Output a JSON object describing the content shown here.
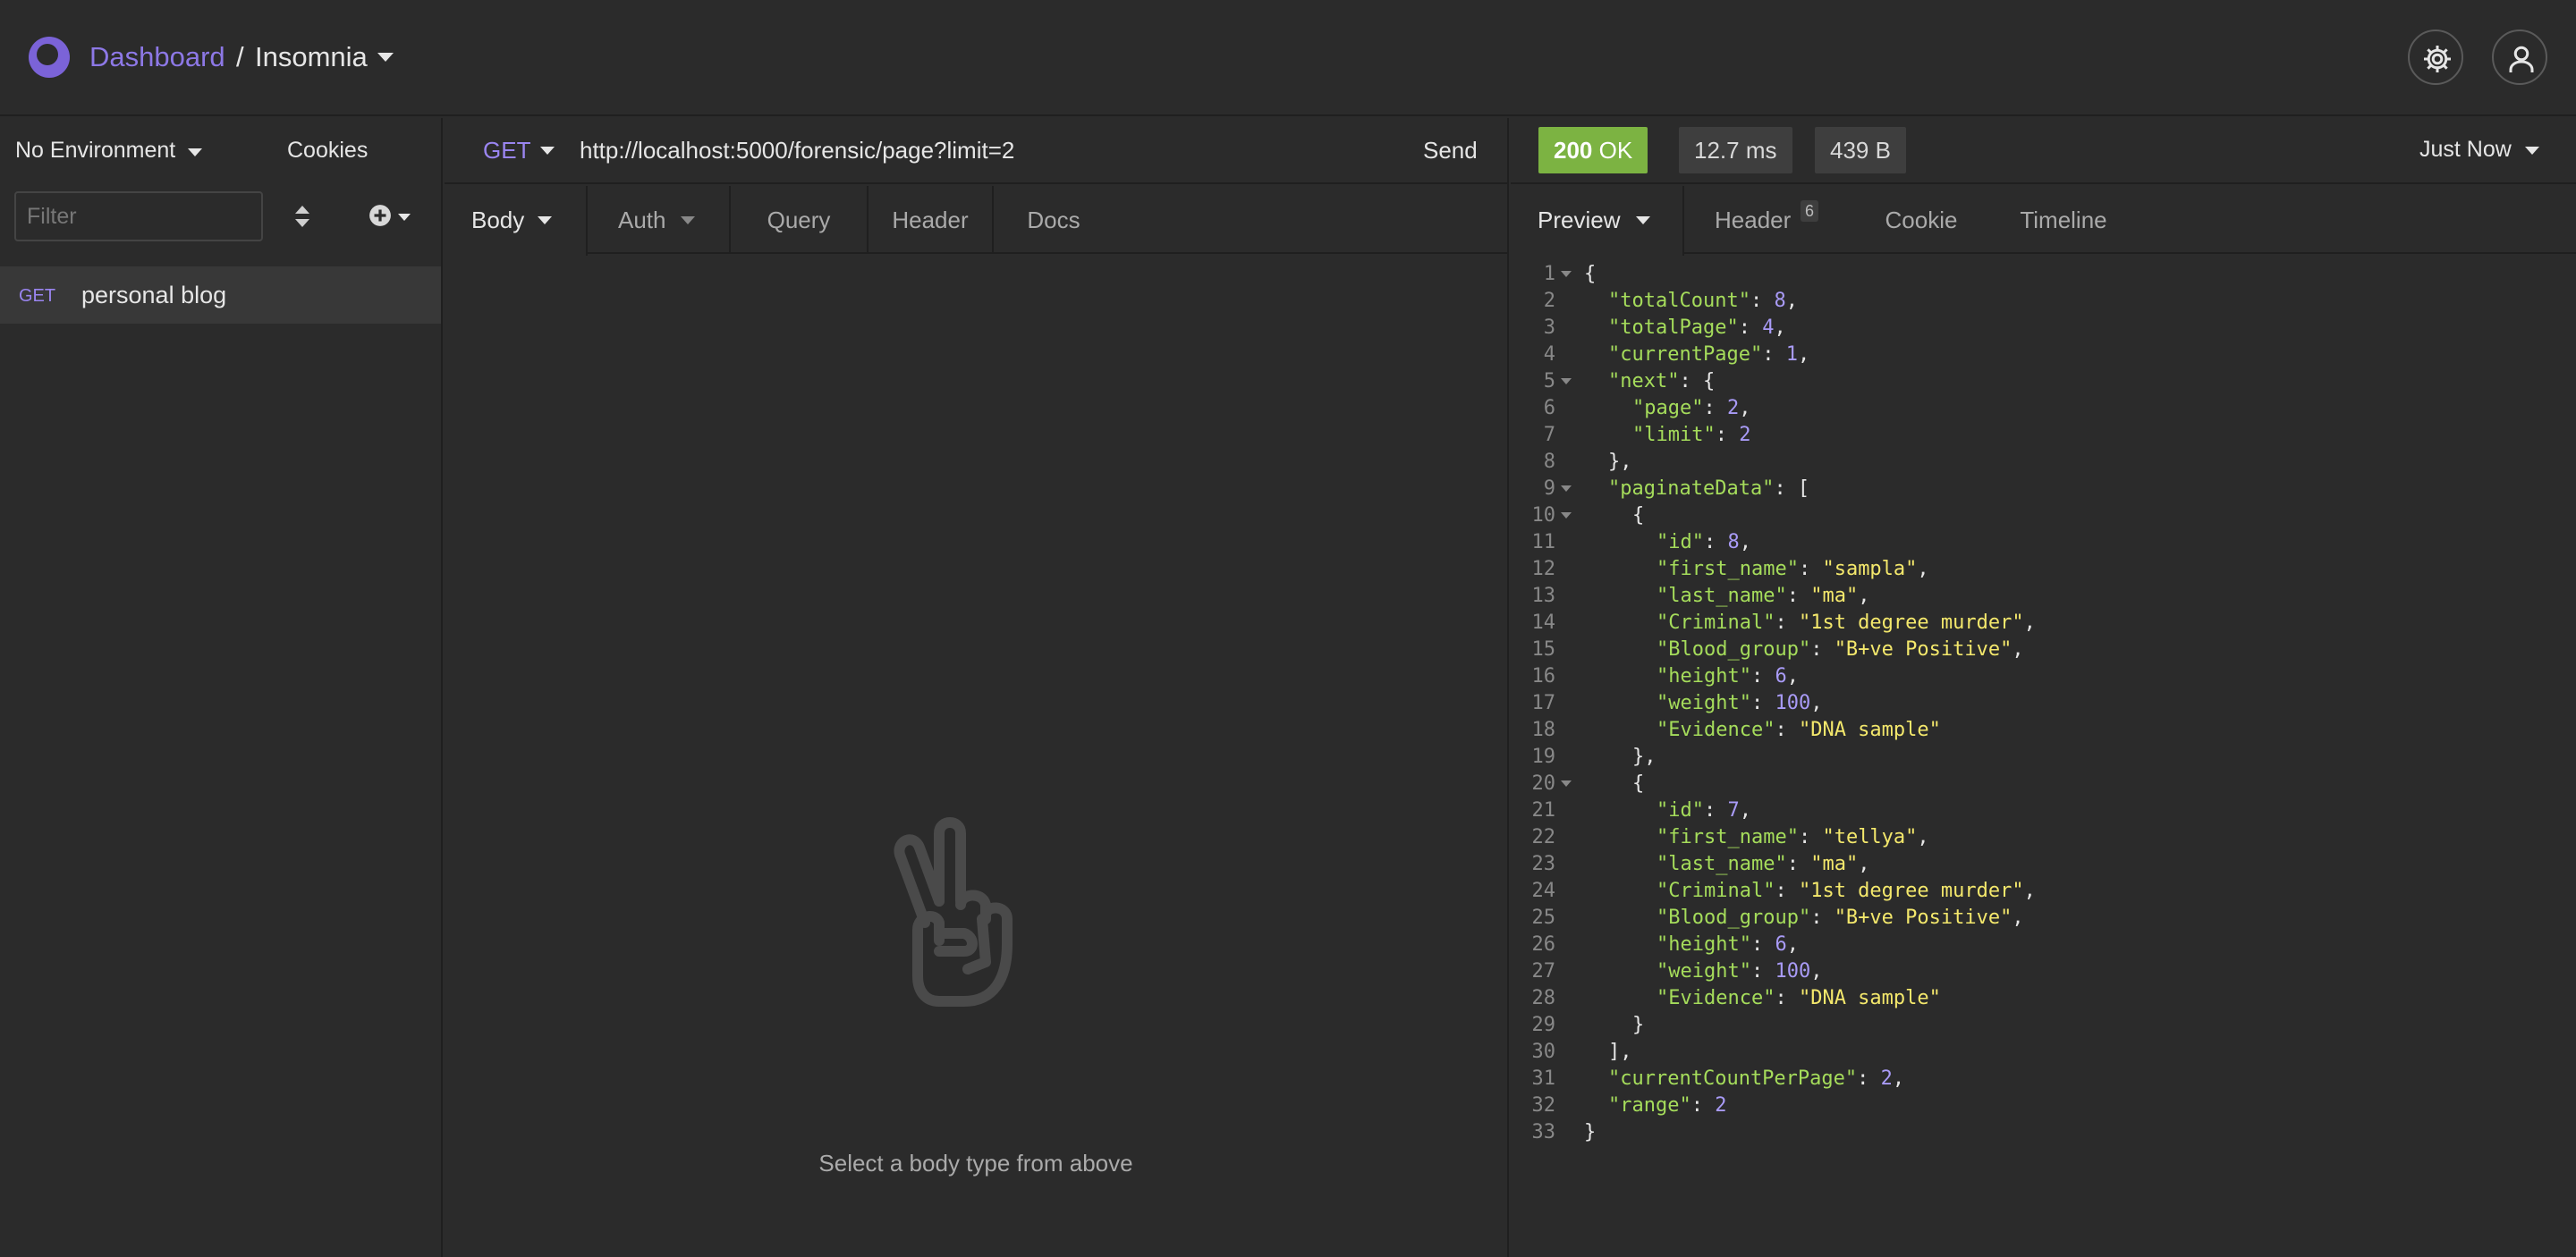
{
  "header": {
    "dashboard_label": "Dashboard",
    "separator": "/",
    "project_label": "Insomnia"
  },
  "sidebar": {
    "environment_label": "No Environment",
    "cookies_label": "Cookies",
    "filter_placeholder": "Filter",
    "requests": [
      {
        "method": "GET",
        "name": "personal blog"
      }
    ]
  },
  "request": {
    "method": "GET",
    "url": "http://localhost:5000/forensic/page?limit=2",
    "send_label": "Send",
    "tabs": {
      "body": "Body",
      "auth": "Auth",
      "query": "Query",
      "header": "Header",
      "docs": "Docs"
    },
    "empty_message": "Select a body type from above"
  },
  "response": {
    "status_code": "200",
    "status_text": "OK",
    "time": "12.7 ms",
    "size": "439 B",
    "history_label": "Just Now",
    "tabs": {
      "preview": "Preview",
      "header": "Header",
      "header_count": "6",
      "cookie": "Cookie",
      "timeline": "Timeline"
    },
    "lines": [
      {
        "n": "1",
        "fold": true,
        "indent": 0,
        "tokens": [
          [
            "p",
            "{"
          ]
        ]
      },
      {
        "n": "2",
        "indent": 1,
        "tokens": [
          [
            "k",
            "\"totalCount\""
          ],
          [
            "p",
            ": "
          ],
          [
            "n",
            "8"
          ],
          [
            "p",
            ","
          ]
        ]
      },
      {
        "n": "3",
        "indent": 1,
        "tokens": [
          [
            "k",
            "\"totalPage\""
          ],
          [
            "p",
            ": "
          ],
          [
            "n",
            "4"
          ],
          [
            "p",
            ","
          ]
        ]
      },
      {
        "n": "4",
        "indent": 1,
        "tokens": [
          [
            "k",
            "\"currentPage\""
          ],
          [
            "p",
            ": "
          ],
          [
            "n",
            "1"
          ],
          [
            "p",
            ","
          ]
        ]
      },
      {
        "n": "5",
        "fold": true,
        "indent": 1,
        "tokens": [
          [
            "k",
            "\"next\""
          ],
          [
            "p",
            ": {"
          ]
        ]
      },
      {
        "n": "6",
        "indent": 2,
        "tokens": [
          [
            "k",
            "\"page\""
          ],
          [
            "p",
            ": "
          ],
          [
            "n",
            "2"
          ],
          [
            "p",
            ","
          ]
        ]
      },
      {
        "n": "7",
        "indent": 2,
        "tokens": [
          [
            "k",
            "\"limit\""
          ],
          [
            "p",
            ": "
          ],
          [
            "n",
            "2"
          ]
        ]
      },
      {
        "n": "8",
        "indent": 1,
        "tokens": [
          [
            "p",
            "},"
          ]
        ]
      },
      {
        "n": "9",
        "fold": true,
        "indent": 1,
        "tokens": [
          [
            "k",
            "\"paginateData\""
          ],
          [
            "p",
            ": ["
          ]
        ]
      },
      {
        "n": "10",
        "fold": true,
        "indent": 2,
        "tokens": [
          [
            "p",
            "{"
          ]
        ]
      },
      {
        "n": "11",
        "indent": 3,
        "tokens": [
          [
            "k",
            "\"id\""
          ],
          [
            "p",
            ": "
          ],
          [
            "n",
            "8"
          ],
          [
            "p",
            ","
          ]
        ]
      },
      {
        "n": "12",
        "indent": 3,
        "tokens": [
          [
            "k",
            "\"first_name\""
          ],
          [
            "p",
            ": "
          ],
          [
            "s",
            "\"sampla\""
          ],
          [
            "p",
            ","
          ]
        ]
      },
      {
        "n": "13",
        "indent": 3,
        "tokens": [
          [
            "k",
            "\"last_name\""
          ],
          [
            "p",
            ": "
          ],
          [
            "s",
            "\"ma\""
          ],
          [
            "p",
            ","
          ]
        ]
      },
      {
        "n": "14",
        "indent": 3,
        "tokens": [
          [
            "k",
            "\"Criminal\""
          ],
          [
            "p",
            ": "
          ],
          [
            "s",
            "\"1st degree murder\""
          ],
          [
            "p",
            ","
          ]
        ]
      },
      {
        "n": "15",
        "indent": 3,
        "tokens": [
          [
            "k",
            "\"Blood_group\""
          ],
          [
            "p",
            ": "
          ],
          [
            "s",
            "\"B+ve Positive\""
          ],
          [
            "p",
            ","
          ]
        ]
      },
      {
        "n": "16",
        "indent": 3,
        "tokens": [
          [
            "k",
            "\"height\""
          ],
          [
            "p",
            ": "
          ],
          [
            "n",
            "6"
          ],
          [
            "p",
            ","
          ]
        ]
      },
      {
        "n": "17",
        "indent": 3,
        "tokens": [
          [
            "k",
            "\"weight\""
          ],
          [
            "p",
            ": "
          ],
          [
            "n",
            "100"
          ],
          [
            "p",
            ","
          ]
        ]
      },
      {
        "n": "18",
        "indent": 3,
        "tokens": [
          [
            "k",
            "\"Evidence\""
          ],
          [
            "p",
            ": "
          ],
          [
            "s",
            "\"DNA sample\""
          ]
        ]
      },
      {
        "n": "19",
        "indent": 2,
        "tokens": [
          [
            "p",
            "},"
          ]
        ]
      },
      {
        "n": "20",
        "fold": true,
        "indent": 2,
        "tokens": [
          [
            "p",
            "{"
          ]
        ]
      },
      {
        "n": "21",
        "indent": 3,
        "tokens": [
          [
            "k",
            "\"id\""
          ],
          [
            "p",
            ": "
          ],
          [
            "n",
            "7"
          ],
          [
            "p",
            ","
          ]
        ]
      },
      {
        "n": "22",
        "indent": 3,
        "tokens": [
          [
            "k",
            "\"first_name\""
          ],
          [
            "p",
            ": "
          ],
          [
            "s",
            "\"tellya\""
          ],
          [
            "p",
            ","
          ]
        ]
      },
      {
        "n": "23",
        "indent": 3,
        "tokens": [
          [
            "k",
            "\"last_name\""
          ],
          [
            "p",
            ": "
          ],
          [
            "s",
            "\"ma\""
          ],
          [
            "p",
            ","
          ]
        ]
      },
      {
        "n": "24",
        "indent": 3,
        "tokens": [
          [
            "k",
            "\"Criminal\""
          ],
          [
            "p",
            ": "
          ],
          [
            "s",
            "\"1st degree murder\""
          ],
          [
            "p",
            ","
          ]
        ]
      },
      {
        "n": "25",
        "indent": 3,
        "tokens": [
          [
            "k",
            "\"Blood_group\""
          ],
          [
            "p",
            ": "
          ],
          [
            "s",
            "\"B+ve Positive\""
          ],
          [
            "p",
            ","
          ]
        ]
      },
      {
        "n": "26",
        "indent": 3,
        "tokens": [
          [
            "k",
            "\"height\""
          ],
          [
            "p",
            ": "
          ],
          [
            "n",
            "6"
          ],
          [
            "p",
            ","
          ]
        ]
      },
      {
        "n": "27",
        "indent": 3,
        "tokens": [
          [
            "k",
            "\"weight\""
          ],
          [
            "p",
            ": "
          ],
          [
            "n",
            "100"
          ],
          [
            "p",
            ","
          ]
        ]
      },
      {
        "n": "28",
        "indent": 3,
        "tokens": [
          [
            "k",
            "\"Evidence\""
          ],
          [
            "p",
            ": "
          ],
          [
            "s",
            "\"DNA sample\""
          ]
        ]
      },
      {
        "n": "29",
        "indent": 2,
        "tokens": [
          [
            "p",
            "}"
          ]
        ]
      },
      {
        "n": "30",
        "indent": 1,
        "tokens": [
          [
            "p",
            "],"
          ]
        ]
      },
      {
        "n": "31",
        "indent": 1,
        "tokens": [
          [
            "k",
            "\"currentCountPerPage\""
          ],
          [
            "p",
            ": "
          ],
          [
            "n",
            "2"
          ],
          [
            "p",
            ","
          ]
        ]
      },
      {
        "n": "32",
        "indent": 1,
        "tokens": [
          [
            "k",
            "\"range\""
          ],
          [
            "p",
            ": "
          ],
          [
            "n",
            "2"
          ]
        ]
      },
      {
        "n": "33",
        "indent": 0,
        "tokens": [
          [
            "p",
            "}"
          ]
        ]
      }
    ]
  },
  "colors": {
    "accent": "#8d78e6",
    "status_ok": "#7cb342",
    "json_key": "#a5dc5b",
    "json_string": "#f4e86c",
    "json_number": "#a99bf7"
  }
}
